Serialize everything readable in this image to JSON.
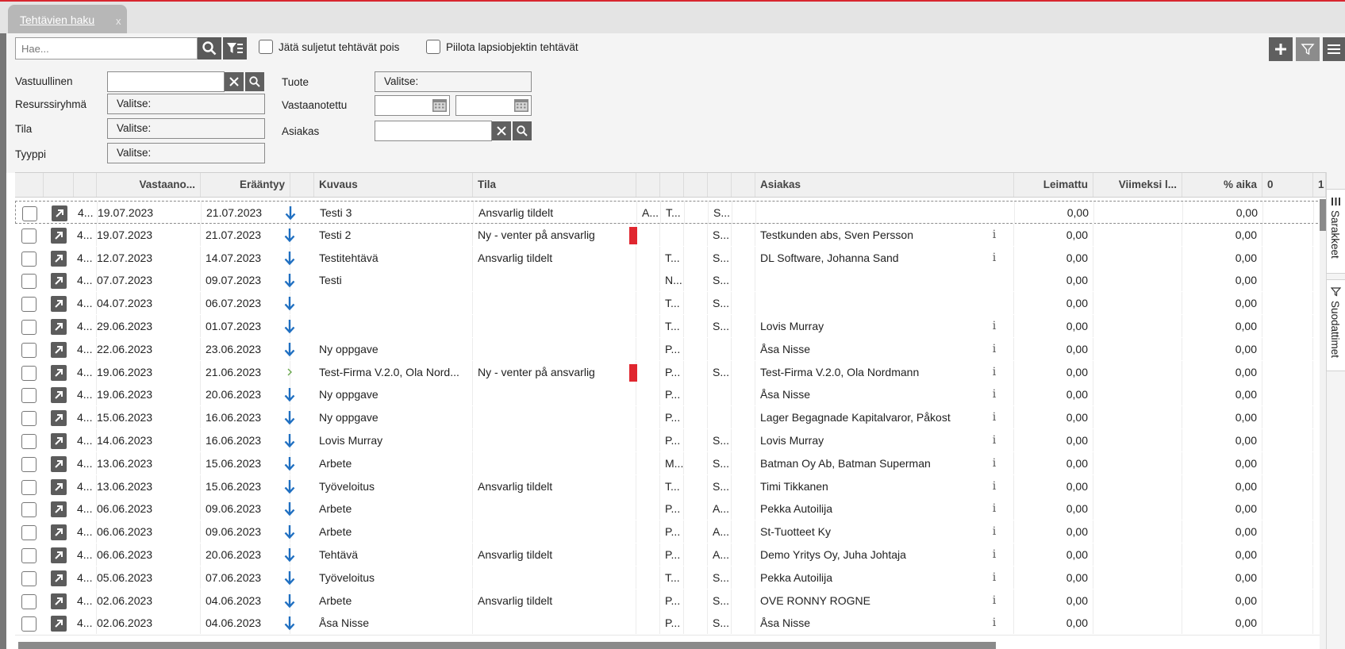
{
  "tab": {
    "label": "Tehtävien haku",
    "close": "x"
  },
  "search": {
    "placeholder": "Hae..."
  },
  "options": {
    "exclude_closed": "Jätä suljetut tehtävät pois",
    "hide_child": "Piilota lapsiobjektin tehtävät"
  },
  "filters": {
    "responsible": {
      "label": "Vastuullinen",
      "value": ""
    },
    "resource_group": {
      "label": "Resurssiryhmä",
      "value": "Valitse:"
    },
    "state": {
      "label": "Tila",
      "value": "Valitse:"
    },
    "type": {
      "label": "Tyyppi",
      "value": "Valitse:"
    },
    "product": {
      "label": "Tuote",
      "value": "Valitse:"
    },
    "received": {
      "label": "Vastaanotettu",
      "from": "",
      "to": ""
    },
    "customer": {
      "label": "Asiakas",
      "value": ""
    }
  },
  "columns": [
    "",
    "",
    "",
    "Vastaano...",
    "Erääntyy",
    "",
    "Kuvaus",
    "Tila",
    "",
    "",
    "",
    "",
    "",
    "Asiakas",
    "Leimattu",
    "Viimeksi l...",
    "% aika",
    "0",
    "1"
  ],
  "rows": [
    {
      "id": "4...",
      "received": "19.07.2023",
      "due": "21.07.2023",
      "prio": "down",
      "desc": "Testi 3",
      "state": "Ansvarlig tildelt",
      "flag": false,
      "c1": "A...",
      "c2": "T...",
      "c3": "",
      "c4": "S...",
      "customer": "",
      "info": false,
      "stamped": "0,00",
      "last": "",
      "pct": "0,00"
    },
    {
      "id": "4...",
      "received": "19.07.2023",
      "due": "21.07.2023",
      "prio": "down",
      "desc": "Testi 2",
      "state": "Ny - venter på ansvarlig",
      "flag": true,
      "c1": "",
      "c2": "",
      "c3": "",
      "c4": "S...",
      "customer": "Testkunden abs, Sven Persson",
      "info": true,
      "stamped": "0,00",
      "last": "",
      "pct": "0,00"
    },
    {
      "id": "4...",
      "received": "12.07.2023",
      "due": "14.07.2023",
      "prio": "down",
      "desc": "Testitehtävä",
      "state": "Ansvarlig tildelt",
      "flag": false,
      "c1": "",
      "c2": "T...",
      "c3": "",
      "c4": "S...",
      "customer": "DL Software, Johanna Sand",
      "info": true,
      "stamped": "0,00",
      "last": "",
      "pct": "0,00"
    },
    {
      "id": "4...",
      "received": "07.07.2023",
      "due": "09.07.2023",
      "prio": "down",
      "desc": "Testi",
      "state": "",
      "flag": false,
      "c1": "",
      "c2": "N...",
      "c3": "",
      "c4": "S...",
      "customer": "",
      "info": false,
      "stamped": "0,00",
      "last": "",
      "pct": "0,00"
    },
    {
      "id": "4...",
      "received": "04.07.2023",
      "due": "06.07.2023",
      "prio": "down",
      "desc": "",
      "state": "",
      "flag": false,
      "c1": "",
      "c2": "T...",
      "c3": "",
      "c4": "S...",
      "customer": "",
      "info": false,
      "stamped": "0,00",
      "last": "",
      "pct": "0,00"
    },
    {
      "id": "4...",
      "received": "29.06.2023",
      "due": "01.07.2023",
      "prio": "down",
      "desc": "",
      "state": "",
      "flag": false,
      "c1": "",
      "c2": "T...",
      "c3": "",
      "c4": "S...",
      "customer": "Lovis Murray",
      "info": true,
      "stamped": "0,00",
      "last": "",
      "pct": "0,00"
    },
    {
      "id": "4...",
      "received": "22.06.2023",
      "due": "23.06.2023",
      "prio": "down",
      "desc": "Ny oppgave",
      "state": "",
      "flag": false,
      "c1": "",
      "c2": "P...",
      "c3": "",
      "c4": "",
      "customer": "Åsa Nisse",
      "info": true,
      "stamped": "0,00",
      "last": "",
      "pct": "0,00"
    },
    {
      "id": "4...",
      "received": "19.06.2023",
      "due": "21.06.2023",
      "prio": "right",
      "desc": "Test-Firma V.2.0, Ola Nord...",
      "state": "Ny - venter på ansvarlig",
      "flag": true,
      "c1": "",
      "c2": "P...",
      "c3": "",
      "c4": "S...",
      "customer": "Test-Firma V.2.0, Ola Nordmann",
      "info": true,
      "stamped": "0,00",
      "last": "",
      "pct": "0,00"
    },
    {
      "id": "4...",
      "received": "19.06.2023",
      "due": "20.06.2023",
      "prio": "down",
      "desc": "Ny oppgave",
      "state": "",
      "flag": false,
      "c1": "",
      "c2": "P...",
      "c3": "",
      "c4": "",
      "customer": "Åsa Nisse",
      "info": true,
      "stamped": "0,00",
      "last": "",
      "pct": "0,00"
    },
    {
      "id": "4...",
      "received": "15.06.2023",
      "due": "16.06.2023",
      "prio": "down",
      "desc": "Ny oppgave",
      "state": "",
      "flag": false,
      "c1": "",
      "c2": "P...",
      "c3": "",
      "c4": "",
      "customer": "Lager Begagnade Kapitalvaror, Påkost",
      "info": true,
      "stamped": "0,00",
      "last": "",
      "pct": "0,00"
    },
    {
      "id": "4...",
      "received": "14.06.2023",
      "due": "16.06.2023",
      "prio": "down",
      "desc": "Lovis Murray",
      "state": "",
      "flag": false,
      "c1": "",
      "c2": "P...",
      "c3": "",
      "c4": "S...",
      "customer": "Lovis Murray",
      "info": true,
      "stamped": "0,00",
      "last": "",
      "pct": "0,00"
    },
    {
      "id": "4...",
      "received": "13.06.2023",
      "due": "15.06.2023",
      "prio": "down",
      "desc": "Arbete",
      "state": "",
      "flag": false,
      "c1": "",
      "c2": "M...",
      "c3": "",
      "c4": "S...",
      "customer": "Batman Oy Ab, Batman Superman",
      "info": true,
      "stamped": "0,00",
      "last": "",
      "pct": "0,00"
    },
    {
      "id": "4...",
      "received": "13.06.2023",
      "due": "15.06.2023",
      "prio": "down",
      "desc": "Työveloitus",
      "state": "Ansvarlig tildelt",
      "flag": false,
      "c1": "",
      "c2": "T...",
      "c3": "",
      "c4": "S...",
      "customer": "Timi Tikkanen",
      "info": true,
      "stamped": "0,00",
      "last": "",
      "pct": "0,00"
    },
    {
      "id": "4...",
      "received": "06.06.2023",
      "due": "09.06.2023",
      "prio": "down",
      "desc": "Arbete",
      "state": "",
      "flag": false,
      "c1": "",
      "c2": "P...",
      "c3": "",
      "c4": "A...",
      "customer": "Pekka Autoilija",
      "info": true,
      "stamped": "0,00",
      "last": "",
      "pct": "0,00"
    },
    {
      "id": "4...",
      "received": "06.06.2023",
      "due": "09.06.2023",
      "prio": "down",
      "desc": "Arbete",
      "state": "",
      "flag": false,
      "c1": "",
      "c2": "P...",
      "c3": "",
      "c4": "A...",
      "customer": "St-Tuotteet Ky",
      "info": true,
      "stamped": "0,00",
      "last": "",
      "pct": "0,00"
    },
    {
      "id": "4...",
      "received": "06.06.2023",
      "due": "20.06.2023",
      "prio": "down",
      "desc": "Tehtävä",
      "state": "Ansvarlig tildelt",
      "flag": false,
      "c1": "",
      "c2": "P...",
      "c3": "",
      "c4": "A...",
      "customer": "Demo Yritys Oy, Juha Johtaja",
      "info": true,
      "stamped": "0,00",
      "last": "",
      "pct": "0,00"
    },
    {
      "id": "4...",
      "received": "05.06.2023",
      "due": "07.06.2023",
      "prio": "down",
      "desc": "Työveloitus",
      "state": "",
      "flag": false,
      "c1": "",
      "c2": "T...",
      "c3": "",
      "c4": "S...",
      "customer": "Pekka Autoilija",
      "info": true,
      "stamped": "0,00",
      "last": "",
      "pct": "0,00"
    },
    {
      "id": "4...",
      "received": "02.06.2023",
      "due": "04.06.2023",
      "prio": "down",
      "desc": "Arbete",
      "state": "Ansvarlig tildelt",
      "flag": false,
      "c1": "",
      "c2": "P...",
      "c3": "",
      "c4": "S...",
      "customer": "OVE RONNY ROGNE",
      "info": true,
      "stamped": "0,00",
      "last": "",
      "pct": "0,00"
    },
    {
      "id": "4...",
      "received": "02.06.2023",
      "due": "04.06.2023",
      "prio": "down",
      "desc": "Åsa Nisse",
      "state": "",
      "flag": false,
      "c1": "",
      "c2": "P...",
      "c3": "",
      "c4": "S...",
      "customer": "Åsa Nisse",
      "info": true,
      "stamped": "0,00",
      "last": "",
      "pct": "0,00"
    }
  ],
  "side": {
    "columns": "Sarakkeet",
    "filters": "Suodattimet"
  },
  "colors": {
    "accent": "#d8262f",
    "flag": "#e0262f",
    "arrow": "#1f6fc1",
    "button": "#5a5a5a"
  }
}
